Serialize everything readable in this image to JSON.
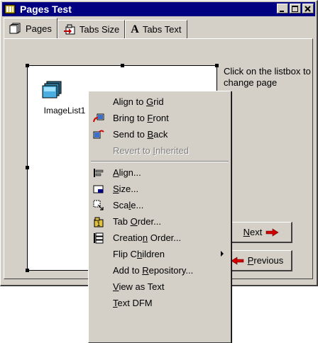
{
  "window": {
    "title": "Pages Test",
    "buttons": [
      "minimize-icon",
      "maximize-icon",
      "close-icon"
    ]
  },
  "tabs": [
    {
      "label": "Pages",
      "icon": "pages-icon",
      "active": true
    },
    {
      "label": "Tabs Size",
      "icon": "tabs-size-icon",
      "active": false
    },
    {
      "label": "Tabs Text",
      "icon": "bold-a-icon",
      "icon_glyph": "A",
      "active": false
    }
  ],
  "component": {
    "caption": "ImageList1",
    "icon": "imagelist-icon"
  },
  "hint": "Click on the listbox to change page",
  "buttons": {
    "next": {
      "pre": "",
      "u": "N",
      "post": "ext",
      "icon": "right-arrow-icon"
    },
    "previous": {
      "pre": "",
      "u": "P",
      "post": "revious",
      "icon": "left-arrow-icon"
    }
  },
  "context_menu": {
    "group1": [
      {
        "pre": "Align to ",
        "u": "G",
        "post": "rid",
        "icon": ""
      },
      {
        "pre": "Bring to ",
        "u": "F",
        "post": "ront",
        "icon": "bring-to-front-icon"
      },
      {
        "pre": "Send to ",
        "u": "B",
        "post": "ack",
        "icon": "send-to-back-icon"
      },
      {
        "pre": "Revert to ",
        "u": "I",
        "post": "nherited",
        "icon": "",
        "disabled": true
      }
    ],
    "group2": [
      {
        "pre": "",
        "u": "A",
        "post": "lign...",
        "icon": "align-icon"
      },
      {
        "pre": "",
        "u": "S",
        "post": "ize...",
        "icon": "size-icon"
      },
      {
        "pre": "Sca",
        "u": "l",
        "post": "e...",
        "icon": "scale-icon"
      },
      {
        "pre": "Tab ",
        "u": "O",
        "post": "rder...",
        "icon": "tab-order-icon"
      },
      {
        "pre": "Creatio",
        "u": "n",
        "post": " Order...",
        "icon": "creation-order-icon"
      },
      {
        "pre": "Flip C",
        "u": "h",
        "post": "ildren",
        "icon": "",
        "submenu": true
      },
      {
        "pre": "Add to ",
        "u": "R",
        "post": "epository...",
        "icon": ""
      },
      {
        "pre": "",
        "u": "V",
        "post": "iew as Text",
        "icon": ""
      },
      {
        "pre": "",
        "u": "T",
        "post": "ext DFM",
        "icon": ""
      }
    ]
  }
}
